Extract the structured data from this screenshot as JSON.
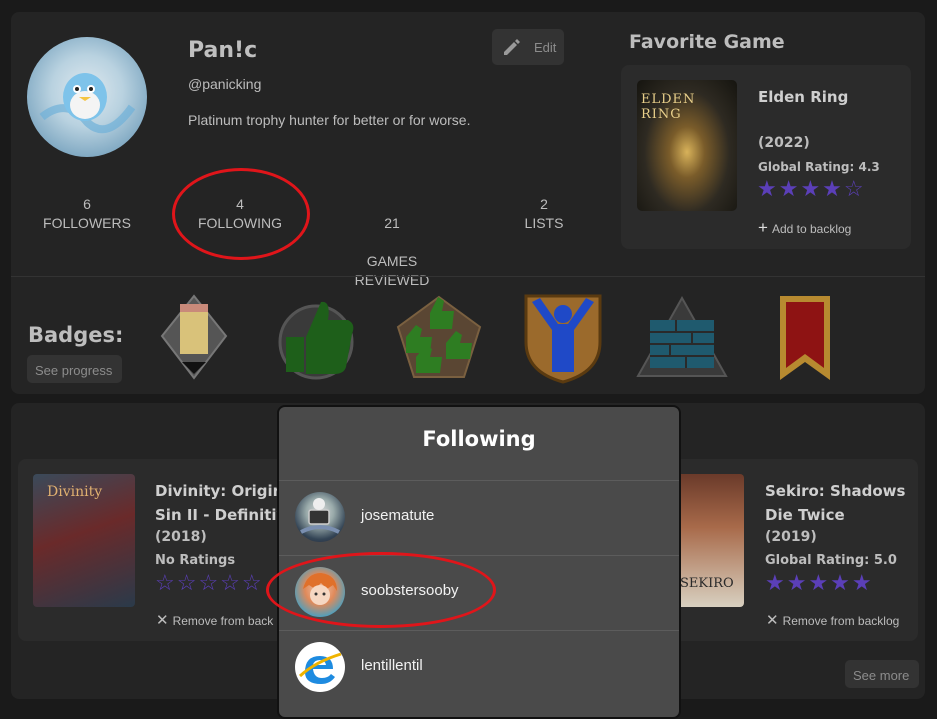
{
  "profile": {
    "name": "Pan!c",
    "handle": "@panicking",
    "bio": "Platinum trophy hunter for better or for worse.",
    "edit_label": "Edit"
  },
  "stats": [
    {
      "num": "6",
      "label": "FOLLOWERS"
    },
    {
      "num": "4",
      "label": "FOLLOWING"
    },
    {
      "num": "21",
      "label": "GAMES\nREVIEWED"
    },
    {
      "num": "2",
      "label": "LISTS"
    }
  ],
  "favorite": {
    "heading": "Favorite Game",
    "title": "Elden Ring",
    "year": "(2022)",
    "rating": "Global Rating: 4.3",
    "stars": 4,
    "add_label": "Add to backlog",
    "cover_text": "ELDEN RING"
  },
  "badges": {
    "label": "Badges:",
    "progress_label": "See progress"
  },
  "backlog": {
    "left": {
      "title": "Divinity: Original Sin II - Definitive",
      "title_line1": "Divinity: Origina",
      "title_line2": "Sin II - Definitiv",
      "year": "(2018)",
      "rating": "No Ratings",
      "remove_label": "Remove from back",
      "cover_text": "Divinity"
    },
    "right": {
      "title_line1": "Sekiro: Shadows",
      "title_line2": "Die Twice",
      "year": "(2019)",
      "rating": "Global Rating: 5.0",
      "remove_label": "Remove from backlog",
      "cover_text": "SEKIRO"
    },
    "see_more": "See more"
  },
  "modal": {
    "title": "Following",
    "users": [
      "josematute",
      "soobstersooby",
      "lentillentil"
    ]
  },
  "colors": {
    "accent_star": "#5b3fb8",
    "annotation_red": "#e0151a"
  }
}
